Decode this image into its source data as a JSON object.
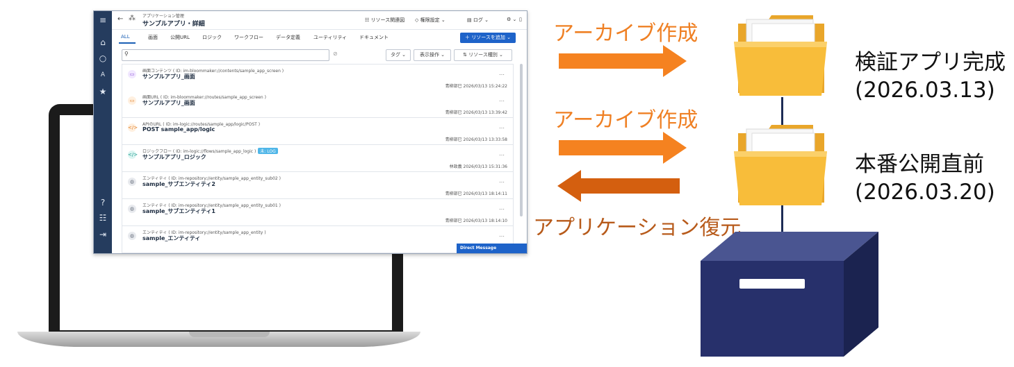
{
  "app": {
    "breadcrumb": "アプリケーション管理",
    "title": "サンプルアプリ・詳細",
    "header_buttons": {
      "relation": "リソース関連図",
      "permission": "権限設定",
      "log": "ログ"
    },
    "tabs": [
      "ALL",
      "画面",
      "公開URL",
      "ロジック",
      "ワークフロー",
      "データ定義",
      "ユーティリティ",
      "ドキュメント"
    ],
    "add_button": "リソースを追加",
    "toolbar": {
      "tag": "タグ",
      "display": "表示操作",
      "resource_type": "リソース種別"
    },
    "rows": [
      {
        "sub": "画面コンテンツ ( ID: im-bloommaker://contents/sample_app_screen )",
        "name": "サンプルアプリ_画面",
        "meta": "青柳部巳 2026/03/13 15:24:22",
        "icon": "▭",
        "color": "#8a4fd6",
        "bg": "#f1e8ff"
      },
      {
        "sub": "画面URL ( ID: im-bloommaker://routes/sample_app_screen )",
        "name": "サンプルアプリ_画面",
        "meta": "青柳部巳 2026/03/13 13:39:42",
        "icon": "▭",
        "color": "#e07a1f",
        "bg": "#fff0e0"
      },
      {
        "sub": "APIのURL ( ID: im-logic://routes/sample_app/logic/POST )",
        "name": "POST sample_app/logic",
        "meta": "青柳部巳 2026/03/13 13:33:58",
        "icon": "</>",
        "color": "#e07a1f",
        "bg": "#fff0e0"
      },
      {
        "sub": "ロジックフロー ( ID: im-logic://flows/sample_app_logic )",
        "name": "サンプルアプリ_ロジック",
        "meta": "林政義 2026/03/13 15:31:36",
        "icon": "</>",
        "color": "#1b9a8c",
        "bg": "#dcf5f2",
        "tag": "未: LOG"
      },
      {
        "sub": "エンティティ ( ID: im-repository://entity/sample_app_entity_sub02 )",
        "name": "sample_サブエンティティ2",
        "meta": "青柳部巳 2026/03/13 18:14:11",
        "icon": "◍",
        "color": "#6b7380",
        "bg": "#e8eaee"
      },
      {
        "sub": "エンティティ ( ID: im-repository://entity/sample_app_entity_sub01 )",
        "name": "sample_サブエンティティ1",
        "meta": "青柳部巳 2026/03/13 18:14:10",
        "icon": "◍",
        "color": "#6b7380",
        "bg": "#e8eaee"
      },
      {
        "sub": "エンティティ ( ID: im-repository://entity/sample_app_entity )",
        "name": "sample_エンティティ",
        "meta": "",
        "icon": "◍",
        "color": "#6b7380",
        "bg": "#e8eaee"
      }
    ],
    "direct_message": "Direct Message"
  },
  "diagram": {
    "arrow1_label": "アーカイブ作成",
    "arrow2_label": "アーカイブ作成",
    "arrow3_label": "アプリケーション復元",
    "archive1_line1": "検証アプリ完成",
    "archive1_line2": "(2026.03.13)",
    "archive2_line1": "本番公開直前",
    "archive2_line2": "(2026.03.20)",
    "colors": {
      "archive_arrow": "#f58220",
      "restore_arrow": "#d45f0f",
      "box": "#27306b",
      "folder": "#f6b631"
    }
  }
}
